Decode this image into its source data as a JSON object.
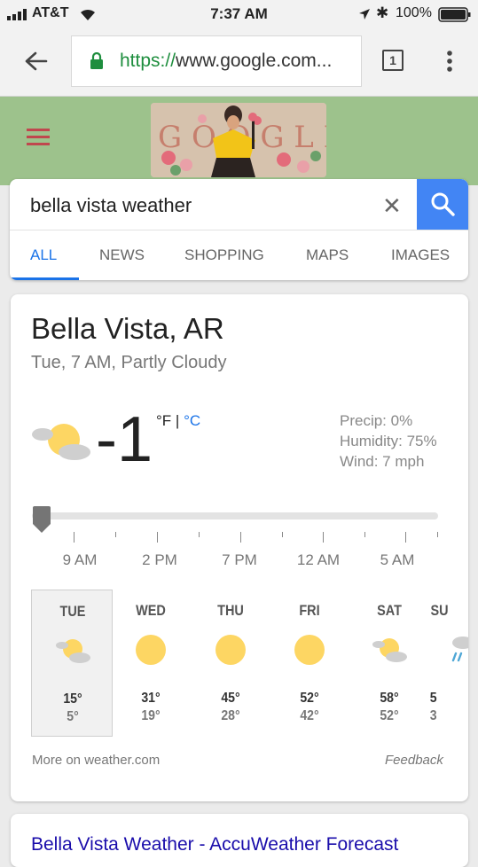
{
  "status": {
    "carrier": "AT&T",
    "time": "7:37 AM",
    "battery": "100%"
  },
  "browser": {
    "url_scheme": "https://",
    "url_host": "www.google.com...",
    "tab_count": "1"
  },
  "search": {
    "query": "bella vista weather",
    "clear": "✕"
  },
  "tabs": [
    "ALL",
    "NEWS",
    "SHOPPING",
    "MAPS",
    "IMAGES"
  ],
  "weather": {
    "location": "Bella Vista, AR",
    "subtitle": "Tue, 7 AM, Partly Cloudy",
    "temp": "-1",
    "unit_f": "°F",
    "unit_sep": " | ",
    "unit_c": "°C",
    "precip": "Precip: 0%",
    "humidity": "Humidity: 75%",
    "wind": "Wind: 7 mph",
    "hours": [
      "9 AM",
      "2 PM",
      "7 PM",
      "12 AM",
      "5 AM"
    ],
    "days": [
      {
        "name": "TUE",
        "hi": "15°",
        "lo": "5°",
        "icon": "partly-cloudy-icon"
      },
      {
        "name": "WED",
        "hi": "31°",
        "lo": "19°",
        "icon": "sun-icon"
      },
      {
        "name": "THU",
        "hi": "45°",
        "lo": "28°",
        "icon": "sun-icon"
      },
      {
        "name": "FRI",
        "hi": "52°",
        "lo": "42°",
        "icon": "sun-icon"
      },
      {
        "name": "SAT",
        "hi": "58°",
        "lo": "52°",
        "icon": "partly-cloudy-icon"
      },
      {
        "name": "SU",
        "hi": "5",
        "lo": "3",
        "icon": "rain-icon"
      }
    ],
    "more": "More on weather.com",
    "feedback": "Feedback"
  },
  "result": {
    "title": "Bella Vista Weather - AccuWeather Forecast"
  },
  "colors": {
    "accent": "#1a73e8",
    "search_button": "#4285f4",
    "doodle_bg": "#9dc28c",
    "sun": "#fdd663",
    "link": "#1a0dab"
  }
}
